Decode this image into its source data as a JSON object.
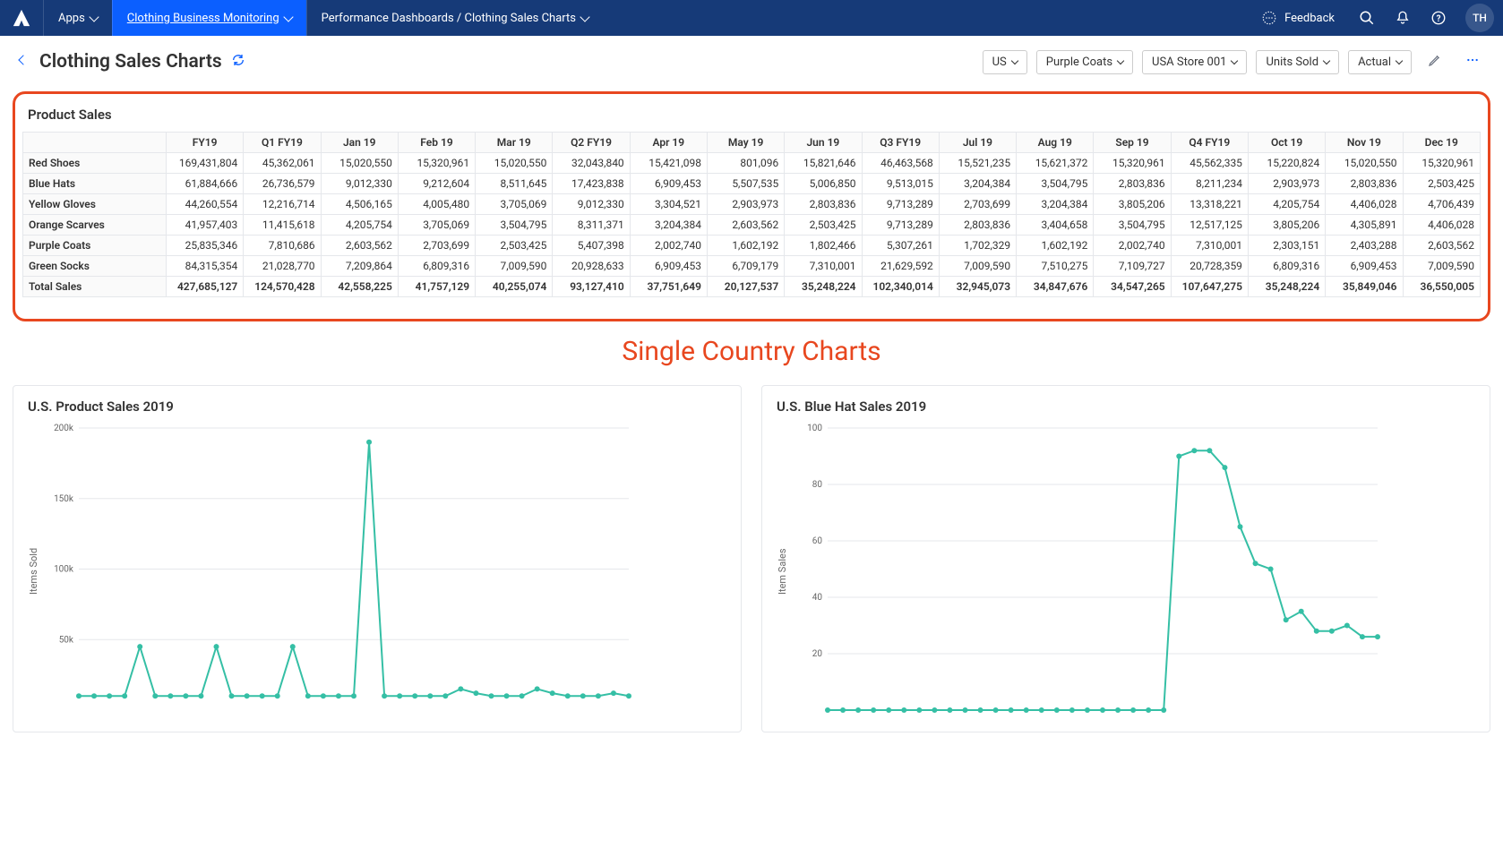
{
  "nav": {
    "apps_label": "Apps",
    "project": "Clothing Business Monitoring",
    "breadcrumb": "Performance Dashboards / Clothing Sales Charts",
    "feedback": "Feedback",
    "avatar": "TH"
  },
  "subhead": {
    "title": "Clothing Sales Charts",
    "filters": [
      "US",
      "Purple Coats",
      "USA Store 001",
      "Units Sold",
      "Actual"
    ]
  },
  "table": {
    "title": "Product Sales",
    "cols": [
      "FY19",
      "Q1 FY19",
      "Jan 19",
      "Feb 19",
      "Mar 19",
      "Q2 FY19",
      "Apr 19",
      "May 19",
      "Jun 19",
      "Q3 FY19",
      "Jul 19",
      "Aug 19",
      "Sep 19",
      "Q4 FY19",
      "Oct 19",
      "Nov 19",
      "Dec 19"
    ],
    "rows": [
      {
        "name": "Red Shoes",
        "vals": [
          "169,431,804",
          "45,362,061",
          "15,020,550",
          "15,320,961",
          "15,020,550",
          "32,043,840",
          "15,421,098",
          "801,096",
          "15,821,646",
          "46,463,568",
          "15,521,235",
          "15,621,372",
          "15,320,961",
          "45,562,335",
          "15,220,824",
          "15,020,550",
          "15,320,961"
        ]
      },
      {
        "name": "Blue Hats",
        "vals": [
          "61,884,666",
          "26,736,579",
          "9,012,330",
          "9,212,604",
          "8,511,645",
          "17,423,838",
          "6,909,453",
          "5,507,535",
          "5,006,850",
          "9,513,015",
          "3,204,384",
          "3,504,795",
          "2,803,836",
          "8,211,234",
          "2,903,973",
          "2,803,836",
          "2,503,425"
        ]
      },
      {
        "name": "Yellow Gloves",
        "vals": [
          "44,260,554",
          "12,216,714",
          "4,506,165",
          "4,005,480",
          "3,705,069",
          "9,012,330",
          "3,304,521",
          "2,903,973",
          "2,803,836",
          "9,713,289",
          "2,703,699",
          "3,204,384",
          "3,805,206",
          "13,318,221",
          "4,205,754",
          "4,406,028",
          "4,706,439"
        ]
      },
      {
        "name": "Orange Scarves",
        "vals": [
          "41,957,403",
          "11,415,618",
          "4,205,754",
          "3,705,069",
          "3,504,795",
          "8,311,371",
          "3,204,384",
          "2,603,562",
          "2,503,425",
          "9,713,289",
          "2,803,836",
          "3,404,658",
          "3,504,795",
          "12,517,125",
          "3,805,206",
          "4,305,891",
          "4,406,028"
        ]
      },
      {
        "name": "Purple Coats",
        "vals": [
          "25,835,346",
          "7,810,686",
          "2,603,562",
          "2,703,699",
          "2,503,425",
          "5,407,398",
          "2,002,740",
          "1,602,192",
          "1,802,466",
          "5,307,261",
          "1,702,329",
          "1,602,192",
          "2,002,740",
          "7,310,001",
          "2,303,151",
          "2,403,288",
          "2,603,562"
        ]
      },
      {
        "name": "Green Socks",
        "vals": [
          "84,315,354",
          "21,028,770",
          "7,209,864",
          "6,809,316",
          "7,009,590",
          "20,928,633",
          "6,909,453",
          "6,709,179",
          "7,310,001",
          "21,629,592",
          "7,009,590",
          "7,510,275",
          "7,109,727",
          "20,728,359",
          "6,809,316",
          "6,909,453",
          "7,009,590"
        ]
      }
    ],
    "total": {
      "name": "Total Sales",
      "vals": [
        "427,685,127",
        "124,570,428",
        "42,558,225",
        "41,757,129",
        "40,255,074",
        "93,127,410",
        "37,751,649",
        "20,127,537",
        "35,248,224",
        "102,340,014",
        "32,945,073",
        "34,847,676",
        "34,547,265",
        "107,647,275",
        "35,248,224",
        "35,849,046",
        "36,550,005"
      ]
    }
  },
  "section_title": "Single Country Charts",
  "chart_data": [
    {
      "type": "line",
      "title": "U.S. Product Sales 2019",
      "ylabel": "Items Sold",
      "ylim": [
        0,
        200
      ],
      "yticks": [
        "50k",
        "100k",
        "150k",
        "200k"
      ],
      "values": [
        10,
        10,
        10,
        10,
        45,
        10,
        10,
        10,
        10,
        45,
        10,
        10,
        10,
        10,
        45,
        10,
        10,
        10,
        10,
        190,
        10,
        10,
        10,
        10,
        10,
        15,
        12,
        10,
        10,
        10,
        15,
        12,
        10,
        10,
        10,
        12,
        10
      ]
    },
    {
      "type": "line",
      "title": "U.S. Blue Hat Sales 2019",
      "ylabel": "Item Sales",
      "ylim": [
        0,
        100
      ],
      "yticks": [
        "20",
        "40",
        "60",
        "80",
        "100"
      ],
      "values": [
        0,
        0,
        0,
        0,
        0,
        0,
        0,
        0,
        0,
        0,
        0,
        0,
        0,
        0,
        0,
        0,
        0,
        0,
        0,
        0,
        0,
        0,
        0,
        90,
        92,
        92,
        86,
        65,
        52,
        50,
        32,
        35,
        28,
        28,
        30,
        26,
        26
      ]
    }
  ],
  "colors": {
    "accent": "#0b5fff",
    "highlight": "#e8471f",
    "chart": "#35bfa5"
  }
}
